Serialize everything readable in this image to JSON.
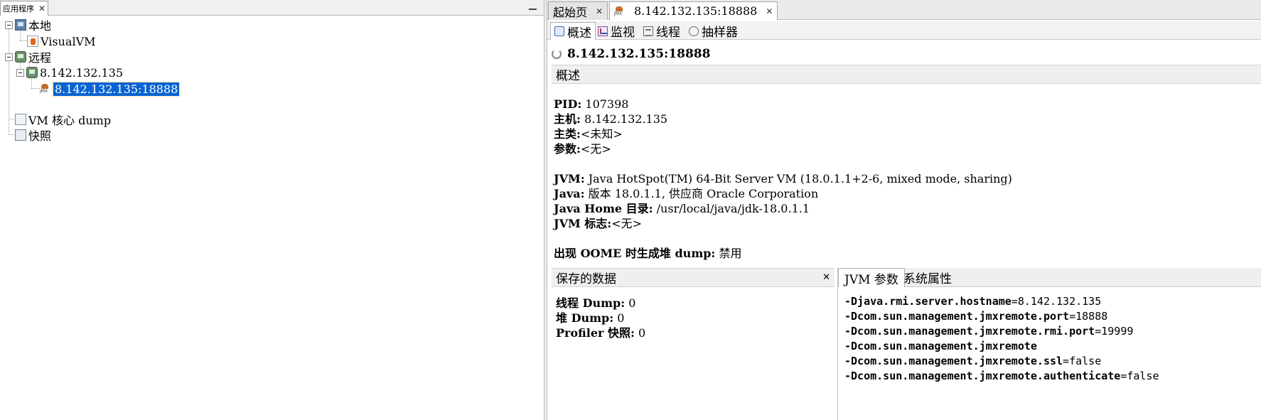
{
  "left": {
    "tab_label": "应用程序",
    "tree": {
      "local_label": "本地",
      "visualvm_label": "VisualVM",
      "remote_label": "远程",
      "host_label": "8.142.132.135",
      "jmx_conn_label": "8.142.132.135:18888",
      "coredump_label": "VM 核心 dump",
      "snapshot_label": "快照"
    }
  },
  "right": {
    "tabs": [
      {
        "label": "起始页"
      },
      {
        "label": "8.142.132.135:18888"
      }
    ],
    "subtabs": [
      {
        "label": "概述"
      },
      {
        "label": "监视"
      },
      {
        "label": "线程"
      },
      {
        "label": "抽样器"
      }
    ],
    "process_title": "8.142.132.135:18888",
    "section_title": "概述",
    "overview": {
      "pid_key": "PID:",
      "pid_val": "107398",
      "host_key": "主机:",
      "host_val": "8.142.132.135",
      "main_key": "主类:",
      "main_val": "<未知>",
      "args_key": "参数:",
      "args_val": "<无>",
      "jvm_key": "JVM:",
      "jvm_val": "Java HotSpot(TM) 64-Bit Server VM (18.0.1.1+2-6, mixed mode, sharing)",
      "java_key": "Java:",
      "java_val": "版本 18.0.1.1, 供应商 Oracle Corporation",
      "javahome_key": "Java Home 目录:",
      "javahome_val": "/usr/local/java/jdk-18.0.1.1",
      "jvmflags_key": "JVM 标志:",
      "jvmflags_val": "<无>",
      "oome_key": "出现 OOME 时生成堆 dump:",
      "oome_val": "禁用"
    },
    "saved_data": {
      "title": "保存的数据",
      "thread_dump_key": "线程 Dump:",
      "thread_dump_val": "0",
      "heap_dump_key": "堆 Dump:",
      "heap_dump_val": "0",
      "profiler_key": "Profiler 快照:",
      "profiler_val": "0"
    },
    "jvm_args": {
      "tabs": [
        {
          "label": "JVM 参数"
        },
        {
          "label": "系统属性"
        }
      ],
      "lines": [
        {
          "key": "-Djava.rmi.server.hostname",
          "val": "=8.142.132.135"
        },
        {
          "key": "-Dcom.sun.management.jmxremote.port",
          "val": "=18888"
        },
        {
          "key": "-Dcom.sun.management.jmxremote.rmi.port",
          "val": "=19999"
        },
        {
          "key": "-Dcom.sun.management.jmxremote",
          "val": ""
        },
        {
          "key": "-Dcom.sun.management.jmxremote.ssl",
          "val": "=false"
        },
        {
          "key": "-Dcom.sun.management.jmxremote.authenticate",
          "val": "=false"
        }
      ]
    }
  }
}
